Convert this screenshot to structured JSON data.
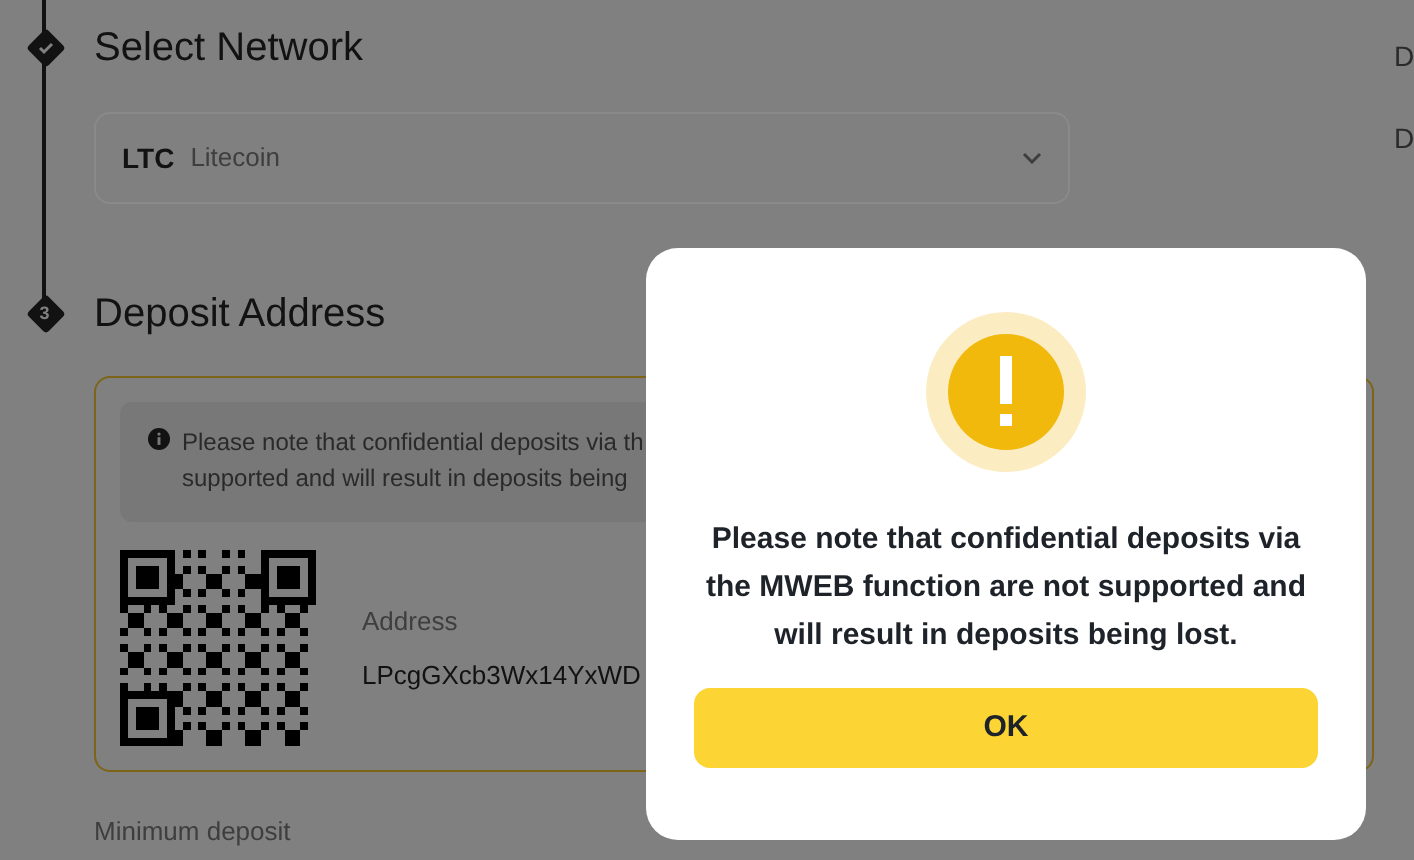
{
  "steps": [
    {
      "kind": "done",
      "title": "Select Network"
    },
    {
      "kind": "number",
      "number": "3",
      "title": "Deposit Address"
    }
  ],
  "network": {
    "code": "LTC",
    "name": "Litecoin"
  },
  "notice_lines": [
    "Please note that confidential deposits via th",
    "supported and will result in deposits being"
  ],
  "address": {
    "label": "Address",
    "value": "LPcgGXcb3Wx14YxWD"
  },
  "minimum_deposit_label": "Minimum deposit",
  "side_labels": [
    "D",
    "D"
  ],
  "dialog": {
    "message": "Please note that confidential deposits via the MWEB function are not supported and will result in deposits being lost.",
    "button": "OK"
  }
}
